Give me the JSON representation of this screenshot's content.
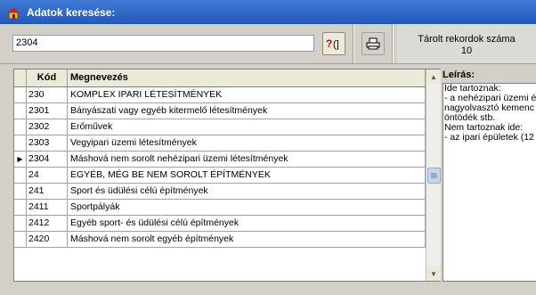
{
  "window": {
    "title": "Adatok keresése:"
  },
  "search": {
    "value": "2304"
  },
  "stats": {
    "label": "Tárolt rekordok száma",
    "count": "10"
  },
  "grid": {
    "columns": [
      "Kód",
      "Megnevezés"
    ],
    "rows": [
      {
        "code": "230",
        "name": "KOMPLEX IPARI LÉTESÍTMÉNYEK",
        "current": false
      },
      {
        "code": "2301",
        "name": "Bányászati vagy egyéb kitermelő létesítmények",
        "current": false
      },
      {
        "code": "2302",
        "name": "Erőművek",
        "current": false
      },
      {
        "code": "2303",
        "name": "Vegyipari üzemi létesítmények",
        "current": false
      },
      {
        "code": "2304",
        "name": "Máshová nem sorolt nehézipari üzemi létesítmények",
        "current": true
      },
      {
        "code": "24",
        "name": "EGYÉB, MÉG BE NEM SOROLT ÉPÍTMÉNYEK",
        "current": false
      },
      {
        "code": "241",
        "name": "Sport és üdülési célú építmények",
        "current": false
      },
      {
        "code": "2411",
        "name": "Sportpályák",
        "current": false
      },
      {
        "code": "2412",
        "name": "Egyéb sport- és üdülési célú építmények",
        "current": false
      },
      {
        "code": "2420",
        "name": "Máshová nem sorolt egyéb építmények",
        "current": false
      }
    ]
  },
  "description": {
    "label": "Leírás:",
    "lines": [
      "Ide tartoznak:",
      "- a nehézipari üzemi é",
      "nagyolvasztó kemenc",
      "öntödék stb.",
      "Nem tartoznak ide:",
      "- az ipari épületek (12"
    ]
  }
}
